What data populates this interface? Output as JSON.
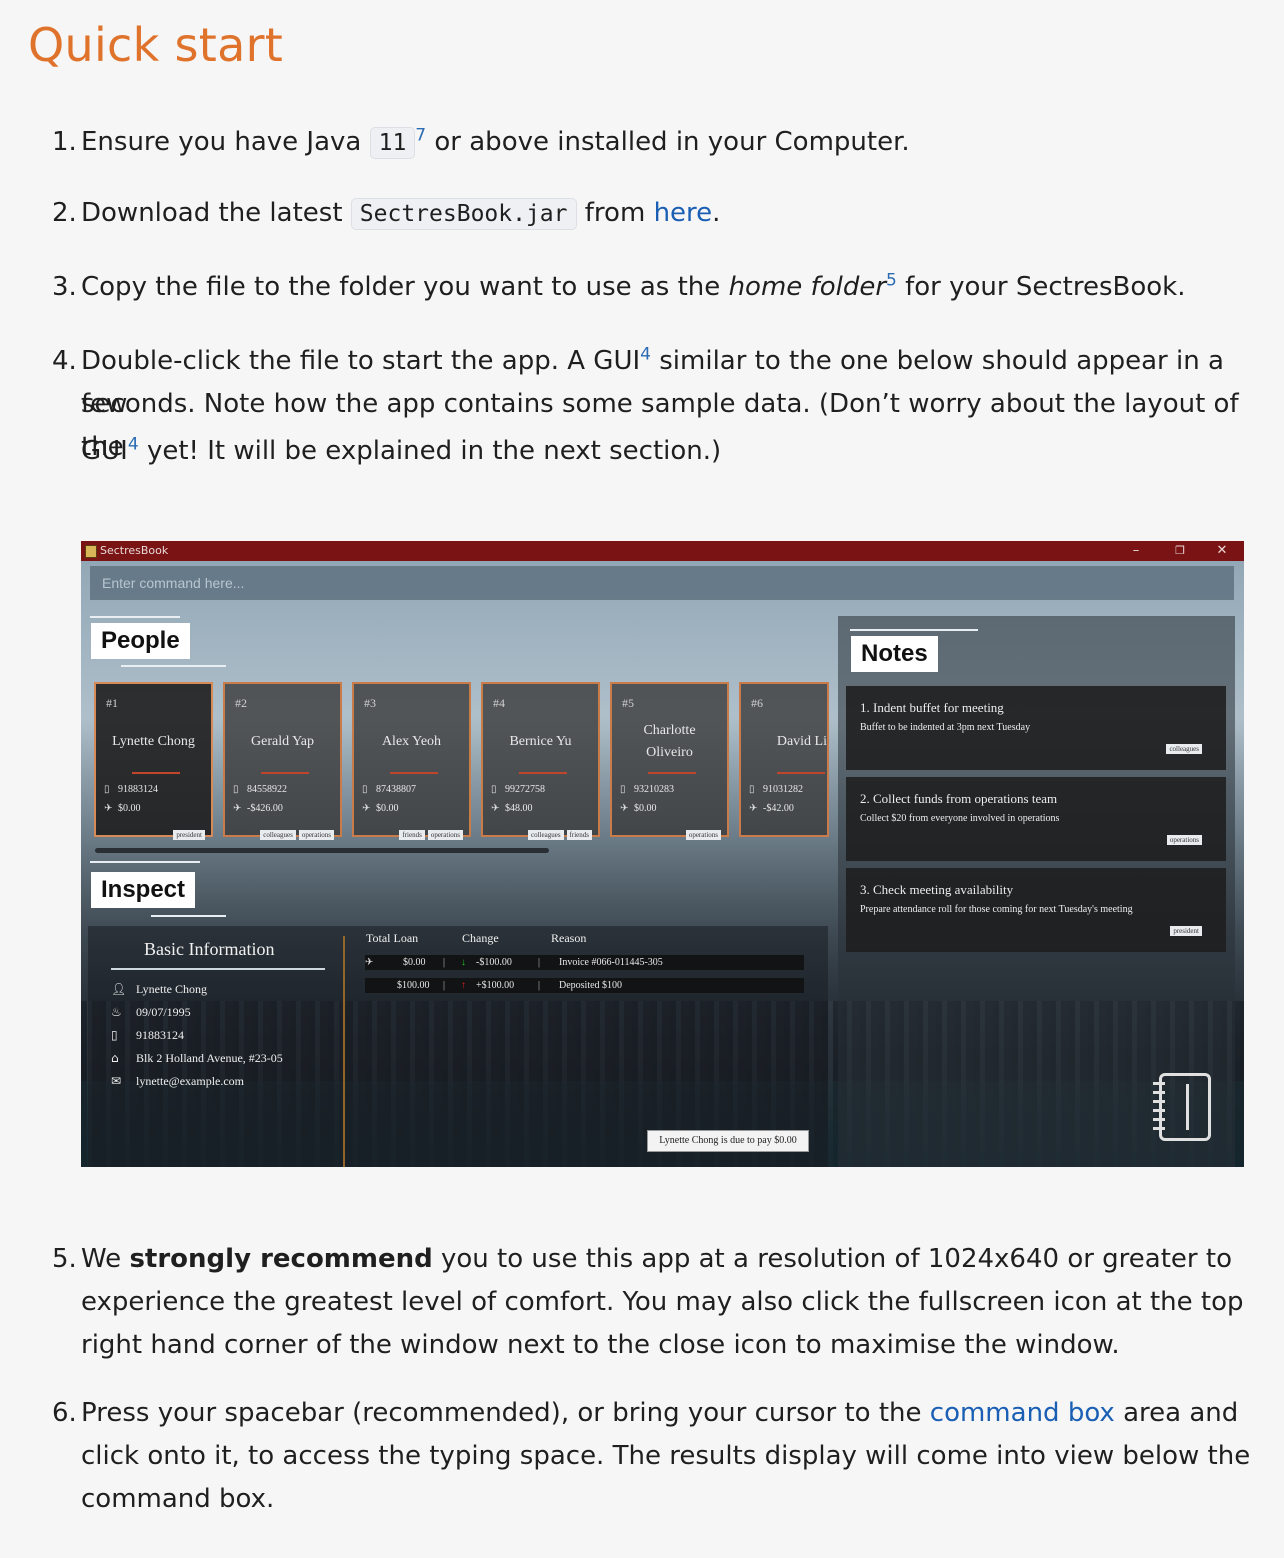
{
  "heading": "Quick start",
  "steps": [
    {
      "num": "1.",
      "pre": "Ensure you have Java ",
      "code": "11",
      "sup": "7",
      "post": " or above installed in your Computer."
    },
    {
      "num": "2.",
      "pre": "Download the latest ",
      "code": "SectresBook.jar",
      "mid": " from ",
      "link": "here",
      "post": "."
    },
    {
      "num": "3.",
      "pre": "Copy the file to the folder you want to use as the ",
      "em": "home folder",
      "sup": "5",
      "post": " for your SectresBook."
    },
    {
      "num": "4.",
      "line1a": "Double-click the file to start the app. A GUI",
      "sup1": "4",
      "line1b": " similar to the one below should appear in a few",
      "line2": "seconds. Note how the app contains some sample data. (Don’t worry about the layout of the",
      "line3a": "GUI",
      "sup2": "4",
      "line3b": " yet! It will be explained in the next section.)"
    },
    {
      "num": "5.",
      "pre": "We ",
      "bold": "strongly recommend",
      "line1": " you to use this app at a resolution of 1024x640 or greater to",
      "line2": "experience the greatest level of comfort. You may also click the fullscreen icon at the top",
      "line3": "right hand corner of the window next to the close icon to maximise the window."
    },
    {
      "num": "6.",
      "pre": "Press your spacebar (recommended), or bring your cursor to the ",
      "link": "command box",
      "line1b": " area and",
      "line2": "click onto it, to access the typing space. The results display will come into view below the",
      "line3": "command box."
    }
  ],
  "app": {
    "title": "SectresBook",
    "window_buttons": {
      "minimize": "–",
      "restore": "❐",
      "close": "✕"
    },
    "command_placeholder": "Enter command here...",
    "people_label": "People",
    "inspect_label": "Inspect",
    "notes_label": "Notes",
    "persons": [
      {
        "idx": "#1",
        "name": "Lynette Chong",
        "phone": "91883124",
        "amount": "$0.00",
        "tags": [
          "president"
        ]
      },
      {
        "idx": "#2",
        "name": "Gerald Yap",
        "phone": "84558922",
        "amount": "-$426.00",
        "tags": [
          "colleagues",
          "operations"
        ]
      },
      {
        "idx": "#3",
        "name": "Alex Yeoh",
        "phone": "87438807",
        "amount": "$0.00",
        "tags": [
          "friends",
          "operations"
        ]
      },
      {
        "idx": "#4",
        "name": "Bernice Yu",
        "phone": "99272758",
        "amount": "$48.00",
        "tags": [
          "colleagues",
          "friends"
        ]
      },
      {
        "idx": "#5",
        "name": "Charlotte Oliveiro",
        "name1": "Charlotte",
        "name2": "Oliveiro",
        "phone": "93210283",
        "amount": "$0.00",
        "tags": [
          "operations"
        ]
      },
      {
        "idx": "#6",
        "name": "David Li",
        "phone": "91031282",
        "amount": "-$42.00",
        "tags": []
      }
    ],
    "basic_info": {
      "title": "Basic Information",
      "name": "Lynette Chong",
      "birthday": "09/07/1995",
      "phone": "91883124",
      "address": "Blk 2 Holland Avenue, #23-05",
      "email": "lynette@example.com"
    },
    "loan_table": {
      "headers": {
        "total": "Total Loan",
        "change": "Change",
        "reason": "Reason"
      },
      "rows": [
        {
          "total": "$0.00",
          "change": "-$100.00",
          "reason": "Invoice #066-011445-305"
        },
        {
          "total": "$100.00",
          "change": "+$100.00",
          "reason": "Deposited $100"
        }
      ]
    },
    "status_message": "Lynette Chong is due to pay $0.00",
    "notes": [
      {
        "title": "1.  Indent buffet for meeting",
        "desc": "Buffet to be indented at 3pm next Tuesday",
        "tag": "colleagues"
      },
      {
        "title": "2.  Collect funds from operations team",
        "desc": "Collect $20 from everyone involved in operations",
        "tag": "operations"
      },
      {
        "title": "3.  Check meeting availability",
        "desc": "Prepare attendance roll for those coming for next Tuesday's meeting",
        "tag": "president"
      }
    ],
    "colors": {
      "titlebar": "#7a1414",
      "card_border": "#c97c4a",
      "heading": "#e0732c",
      "link": "#1a5fb4"
    }
  }
}
